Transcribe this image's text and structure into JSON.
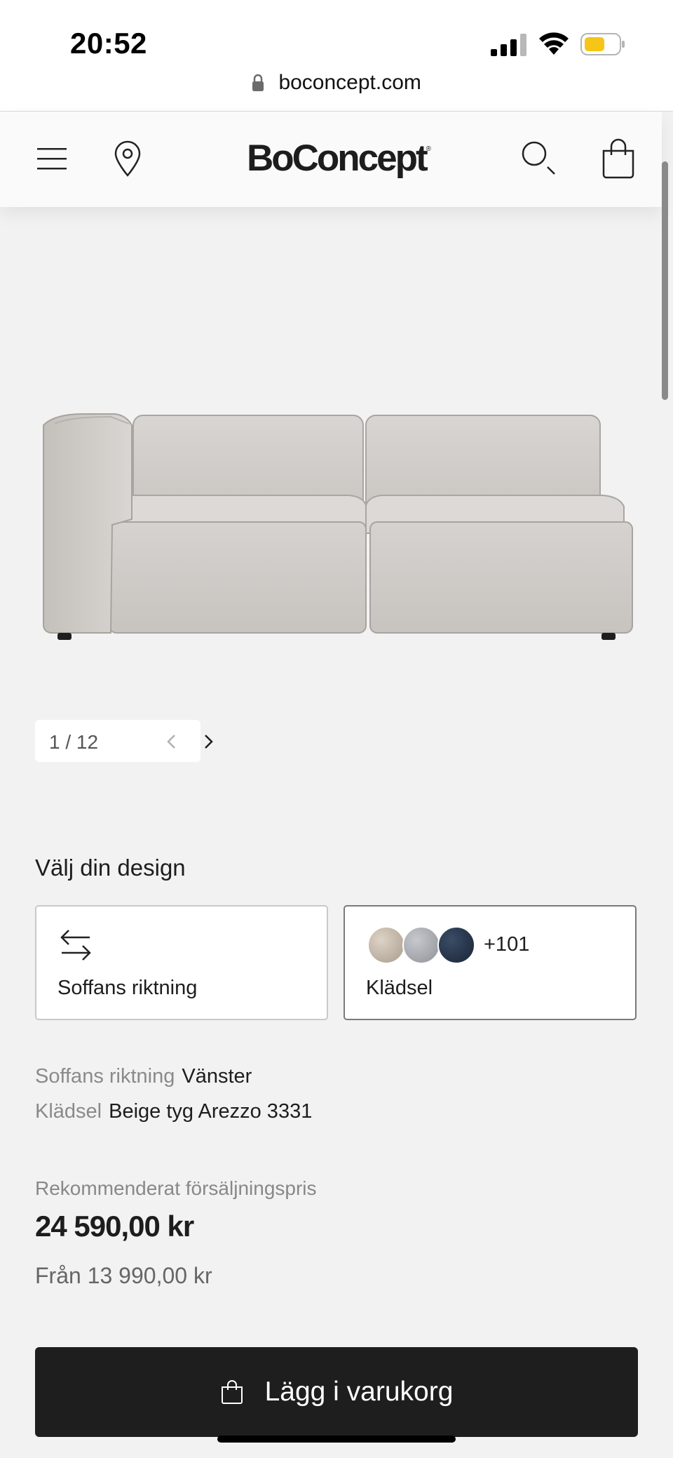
{
  "status_bar": {
    "time": "20:52"
  },
  "browser": {
    "url": "boconcept.com"
  },
  "header": {
    "logo": "BoConcept",
    "logo_mark": "®"
  },
  "gallery": {
    "counter": "1 / 12"
  },
  "design": {
    "heading": "Välj din design",
    "direction_card_label": "Soffans riktning",
    "fabric_card_label": "Klädsel",
    "fabric_more_count": "+101"
  },
  "specs": [
    {
      "key": "Soffans riktning",
      "value": "Vänster"
    },
    {
      "key": "Klädsel",
      "value": "Beige tyg Arezzo 3331"
    }
  ],
  "price": {
    "label": "Rekommenderat försäljningspris",
    "value": "24 590,00 kr",
    "from": "Från 13 990,00 kr"
  },
  "cart": {
    "button_label": "Lägg i varukorg"
  },
  "colors": {
    "page_bg": "#f2f2f2",
    "text": "#1d1d1d",
    "button_bg": "#1e1e1e",
    "battery_fill": "#f5c518",
    "sofa_fabric": "#d1cdc9"
  }
}
